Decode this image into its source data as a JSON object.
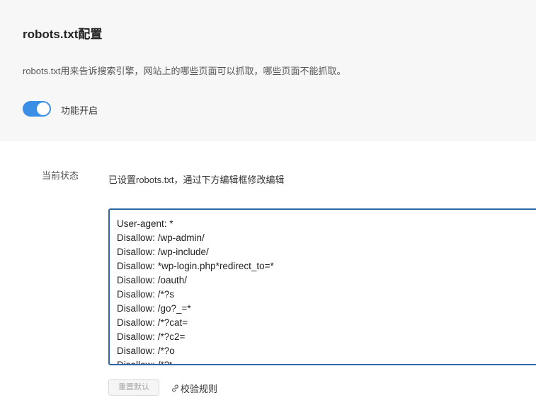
{
  "config": {
    "title": "robots.txt配置",
    "description": "robots.txt用来告诉搜索引擎，网站上的哪些页面可以抓取，哪些页面不能抓取。",
    "toggle_label": "功能开启",
    "toggle_on": true
  },
  "status": {
    "label": "当前状态",
    "value": "已设置robots.txt，通过下方编辑框修改编辑"
  },
  "editor": {
    "lines": [
      "User-agent: *",
      "Disallow: /wp-admin/",
      "Disallow: /wp-include/",
      "Disallow: *wp-login.php*redirect_to=*",
      "Disallow: /oauth/",
      "Disallow: /*?s",
      "Disallow: /go?_=*",
      "Disallow: /*?cat=",
      "Disallow: /*?c2=",
      "Disallow: /*?o",
      "Disallow: /*?t"
    ]
  },
  "actions": {
    "reset_label": "重置默认",
    "verify_label": "校验规则",
    "verify_icon": "link-icon"
  },
  "colors": {
    "accent": "#3a8ee6",
    "editor_border": "#2b67a6"
  }
}
